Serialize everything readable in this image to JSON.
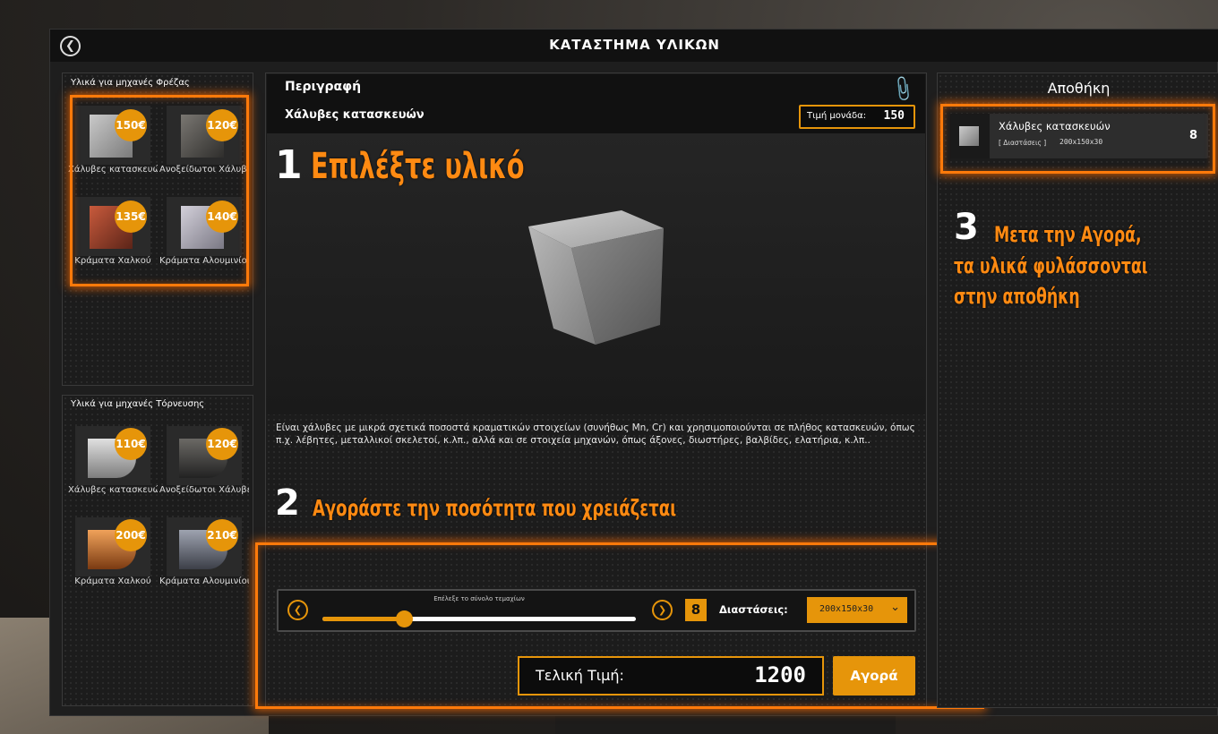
{
  "window": {
    "title": "ΚΑΤΑΣΤΗΜΑ ΥΛΙΚΩΝ"
  },
  "left": {
    "milling": {
      "heading": "Υλικά για μηχανές Φρέζας",
      "items": [
        {
          "name": "Χάλυβες κατασκευών",
          "price": "150€",
          "color": "#9a9a9a"
        },
        {
          "name": "Ανοξείδωτοι Χάλυβες",
          "price": "120€",
          "color": "#6b6862"
        },
        {
          "name": "Κράματα Χαλκού",
          "price": "135€",
          "color": "#b4472f"
        },
        {
          "name": "Κράματα Αλουμινίου",
          "price": "140€",
          "color": "#a9a6b0"
        }
      ]
    },
    "turning": {
      "heading": "Υλικά για μηχανές Τόρνευσης",
      "items": [
        {
          "name": "Χάλυβες κατασκευών",
          "price": "110€",
          "color": "#9a9a9a"
        },
        {
          "name": "Ανοξείδωτοι Χάλυβες",
          "price": "120€",
          "color": "#5d5b57"
        },
        {
          "name": "Κράματα Χαλκού",
          "price": "200€",
          "color": "#c8762d"
        },
        {
          "name": "Κράματα Αλουμινίου",
          "price": "210€",
          "color": "#8c8f99"
        }
      ]
    }
  },
  "center": {
    "description_label": "Περιγραφή",
    "product_name": "Χάλυβες κατασκευών",
    "unit_price_label": "Τιμή μονάδα:",
    "unit_price": "150",
    "description": "Είναι χάλυβες με μικρά σχετικά ποσοστά κραματικών στοιχείων (συνήθως Mn, Cr) και χρησιμοποιούνται σε πλήθος κατασκευών, όπως π.χ. λέβητες, μεταλλικοί σκελετοί, κ.λπ., αλλά και σε στοιχεία μηχανών, όπως άξονες, διωστήρες, βαλβίδες, ελατήρια, κ.λπ..",
    "slider_caption": "Επέλεξε το σύνολο τεμαχίων",
    "slider_fraction": 0.26,
    "quantity": "8",
    "dimensions_label": "Διαστάσεις:",
    "dimensions_value": "200x150x30",
    "total_label": "Τελική Τιμή:",
    "total_value": "1200",
    "buy_label": "Αγορά"
  },
  "storage": {
    "title": "Αποθήκη",
    "item_name": "Χάλυβες κατασκευών",
    "item_dim_label": "[ Διαστάσεις ]",
    "item_dim_value": "200x150x30",
    "item_count": "8"
  },
  "annotations": {
    "step1_num": "1",
    "step1_text": "Επιλέξτε υλικό",
    "step2_num": "2",
    "step2_text": "Αγοράστε την ποσότητα που χρειάζεται",
    "step3_num": "3",
    "step3_line1": "Μετα την Αγορά,",
    "step3_line2": "τα υλικά φυλάσσονται",
    "step3_line3": "στην αποθήκη"
  },
  "colors": {
    "accent": "#e6950a",
    "highlight": "#ff7a0a",
    "annotation": "#ff8a12"
  }
}
